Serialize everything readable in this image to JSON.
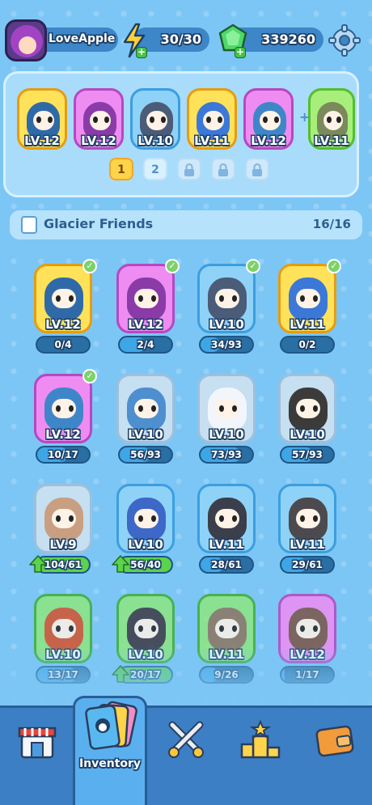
{
  "player": {
    "name": "LoveApple"
  },
  "resources": {
    "energy": "30/30",
    "gems": "339260"
  },
  "team": {
    "members": [
      {
        "level": "LV.12",
        "frame": "yellow",
        "body": "#2f6aa8"
      },
      {
        "level": "LV.12",
        "frame": "purple",
        "body": "#8a3ba8"
      },
      {
        "level": "LV.10",
        "frame": "blue",
        "body": "#4b5c78"
      },
      {
        "level": "LV.11",
        "frame": "yellow",
        "body": "#3b78d8"
      },
      {
        "level": "LV.12",
        "frame": "purple",
        "body": "#3f86c9"
      }
    ],
    "reserve": {
      "level": "LV.11",
      "frame": "lime",
      "body": "#7a8a5a"
    },
    "pages": [
      "1",
      "2"
    ],
    "locked_pages": 3,
    "active_page": 0
  },
  "section": {
    "title": "Glacier Friends",
    "count": "16/16"
  },
  "cards": [
    {
      "level": "LV.12",
      "progress": "0/4",
      "ratio": 0.0,
      "frame": "yellow",
      "body": "#2f6aa8",
      "checked": true,
      "upgrade": false
    },
    {
      "level": "LV.12",
      "progress": "2/4",
      "ratio": 0.5,
      "frame": "purple",
      "body": "#8a3ba8",
      "checked": true,
      "upgrade": false
    },
    {
      "level": "LV.10",
      "progress": "34/93",
      "ratio": 0.37,
      "frame": "blue",
      "body": "#4b5c78",
      "checked": true,
      "upgrade": false
    },
    {
      "level": "LV.11",
      "progress": "0/2",
      "ratio": 0.0,
      "frame": "yellow",
      "body": "#3b78d8",
      "checked": true,
      "upgrade": false
    },
    {
      "level": "LV.12",
      "progress": "10/17",
      "ratio": 0.59,
      "frame": "purple",
      "body": "#3f86c9",
      "checked": true,
      "upgrade": false
    },
    {
      "level": "LV.10",
      "progress": "56/93",
      "ratio": 0.6,
      "frame": "gray",
      "body": "#4e8fd0",
      "checked": false,
      "upgrade": false
    },
    {
      "level": "LV.10",
      "progress": "73/93",
      "ratio": 0.78,
      "frame": "gray",
      "body": "#f2f6fb",
      "checked": false,
      "upgrade": false
    },
    {
      "level": "LV.10",
      "progress": "57/93",
      "ratio": 0.61,
      "frame": "gray",
      "body": "#3d3a3a",
      "checked": false,
      "upgrade": false
    },
    {
      "level": "LV.9",
      "progress": "104/61",
      "ratio": 1.0,
      "frame": "gray",
      "body": "#c99f82",
      "checked": false,
      "upgrade": true
    },
    {
      "level": "LV.10",
      "progress": "56/40",
      "ratio": 1.0,
      "frame": "blue",
      "body": "#3d68c8",
      "checked": false,
      "upgrade": true
    },
    {
      "level": "LV.11",
      "progress": "28/61",
      "ratio": 0.46,
      "frame": "blue",
      "body": "#3b3f4c",
      "checked": false,
      "upgrade": false
    },
    {
      "level": "LV.11",
      "progress": "29/61",
      "ratio": 0.48,
      "frame": "blue",
      "body": "#4d4a4f",
      "checked": false,
      "upgrade": false
    },
    {
      "level": "LV.10",
      "progress": "13/17",
      "ratio": 0.76,
      "frame": "green",
      "body": "#d3542e",
      "checked": false,
      "upgrade": false
    },
    {
      "level": "LV.10",
      "progress": "20/17",
      "ratio": 1.0,
      "frame": "green",
      "body": "#3d3a44",
      "checked": false,
      "upgrade": true
    },
    {
      "level": "LV.11",
      "progress": "9/26",
      "ratio": 0.35,
      "frame": "green",
      "body": "#8d7660",
      "checked": false,
      "upgrade": false
    },
    {
      "level": "LV.12",
      "progress": "1/17",
      "ratio": 0.06,
      "frame": "purple",
      "body": "#7b5548",
      "checked": false,
      "upgrade": false
    }
  ],
  "nav": {
    "items": [
      {
        "name": "shop",
        "icon": "shop-icon",
        "label": ""
      },
      {
        "name": "inventory",
        "icon": "cards-icon",
        "label": "Inventory"
      },
      {
        "name": "battle",
        "icon": "crossed-swords-icon",
        "label": ""
      },
      {
        "name": "ranking",
        "icon": "podium-icon",
        "label": ""
      },
      {
        "name": "wallet",
        "icon": "wallet-icon",
        "label": ""
      }
    ],
    "active": 1
  }
}
